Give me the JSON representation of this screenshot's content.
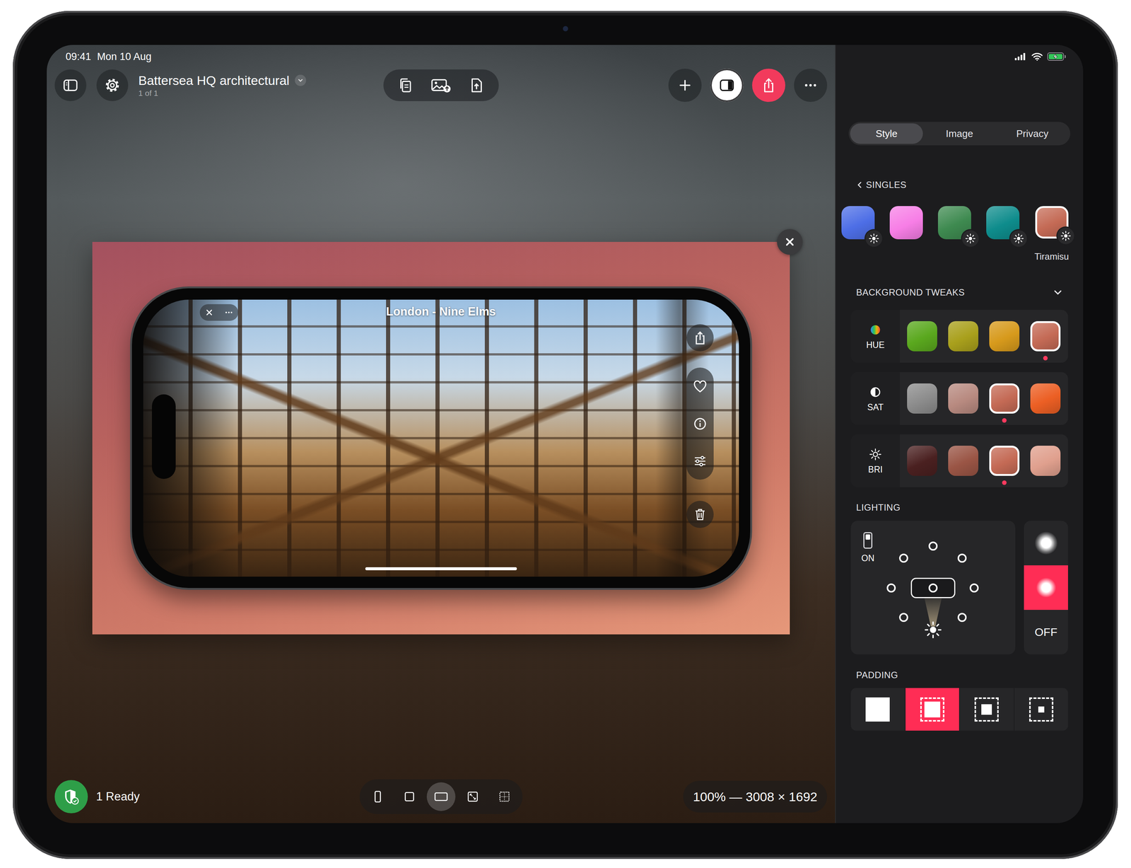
{
  "status_bar": {
    "time": "09:41",
    "date": "Mon 10 Aug",
    "battery": {
      "level": 1,
      "charging": true
    }
  },
  "document": {
    "title": "Battersea HQ architectural",
    "page": "1 of 1"
  },
  "toolbar": {
    "tools": [
      {
        "kind": "copy"
      },
      {
        "kind": "image"
      },
      {
        "kind": "export"
      }
    ],
    "actions": [
      {
        "kind": "add",
        "selected": false
      },
      {
        "kind": "inspector",
        "selected": true
      },
      {
        "kind": "share",
        "selected": false
      },
      {
        "kind": "more",
        "selected": false
      }
    ]
  },
  "canvas": {
    "screenshot": {
      "title": "London - Nine Elms"
    }
  },
  "bottom_bar": {
    "status": "1 Ready",
    "aspect_modes": [
      {
        "kind": "portrait",
        "selected": false
      },
      {
        "kind": "square",
        "selected": false
      },
      {
        "kind": "landscape",
        "selected": true
      },
      {
        "kind": "fit",
        "selected": false
      },
      {
        "kind": "grid",
        "selected": false
      }
    ],
    "zoom": "100% — 3008 × 1692"
  },
  "inspector": {
    "tabs": [
      {
        "label": "Style",
        "selected": true
      },
      {
        "label": "Image",
        "selected": false
      },
      {
        "label": "Privacy",
        "selected": false
      }
    ],
    "back_label": "SINGLES",
    "presets": [
      {
        "color": "#4d6ee6",
        "light": true,
        "selected": false
      },
      {
        "color": "#f77ee6",
        "light": false,
        "selected": false
      },
      {
        "color": "#3e8a50",
        "light": true,
        "selected": false
      },
      {
        "color": "#0e8c8c",
        "light": true,
        "selected": false
      },
      {
        "name": "Tiramisu",
        "color": "#c46a55",
        "light": true,
        "selected": true
      },
      {
        "color": "#e0262e",
        "light": false,
        "selected": false
      }
    ],
    "tweaks": {
      "label": "BACKGROUND TWEAKS",
      "expanded": true,
      "rows": [
        {
          "kind": "hue",
          "label": "HUE",
          "options": [
            {
              "color": "#5aa81e",
              "selected": false
            },
            {
              "color": "#a9a01c",
              "selected": false
            },
            {
              "color": "#d79a1c",
              "selected": false
            },
            {
              "color": "#c46a55",
              "selected": true
            }
          ]
        },
        {
          "kind": "sat",
          "label": "SAT",
          "options": [
            {
              "color": "#8c8c8c",
              "selected": false
            },
            {
              "color": "#b88a80",
              "selected": false
            },
            {
              "color": "#c46a55",
              "selected": true
            },
            {
              "color": "#ec5f24",
              "selected": false
            }
          ]
        },
        {
          "kind": "bri",
          "label": "BRI",
          "options": [
            {
              "color": "#4a2020",
              "selected": false
            },
            {
              "color": "#9a5545",
              "selected": false
            },
            {
              "color": "#c46a55",
              "selected": true
            },
            {
              "color": "#e0a08e",
              "selected": false
            }
          ]
        }
      ]
    },
    "lighting": {
      "label": "LIGHTING",
      "enabled": true,
      "toggle_label": "ON",
      "positions": [
        {
          "kind": "top",
          "selected": false
        },
        {
          "kind": "top-left",
          "selected": false
        },
        {
          "kind": "top-right",
          "selected": false
        },
        {
          "kind": "left",
          "selected": false
        },
        {
          "kind": "center",
          "selected": true
        },
        {
          "kind": "right",
          "selected": false
        },
        {
          "kind": "bottom-left",
          "selected": false
        },
        {
          "kind": "bottom-right",
          "selected": false
        }
      ],
      "intensity": [
        {
          "kind": "soft",
          "selected": false
        },
        {
          "kind": "strong",
          "selected": true
        },
        {
          "kind": "off",
          "label": "OFF",
          "selected": false
        }
      ]
    },
    "padding": {
      "label": "PADDING",
      "options": [
        {
          "kind": "none",
          "selected": false
        },
        {
          "kind": "small",
          "selected": true
        },
        {
          "kind": "medium",
          "selected": false
        },
        {
          "kind": "large",
          "selected": false
        }
      ]
    }
  }
}
